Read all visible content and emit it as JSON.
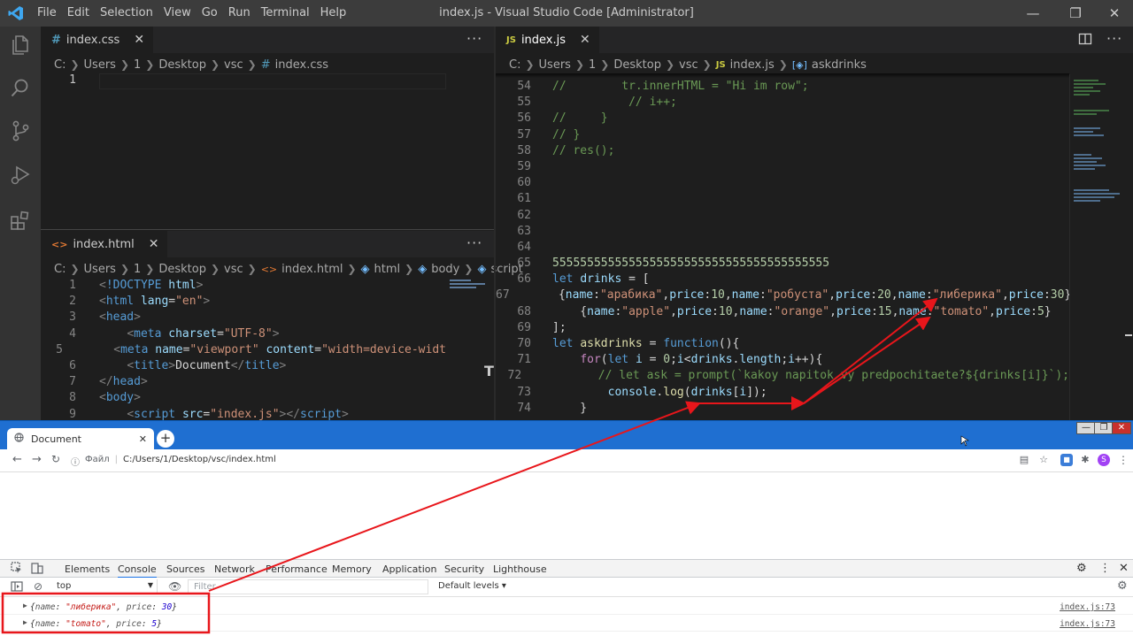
{
  "titlebar": {
    "menu": [
      "File",
      "Edit",
      "Selection",
      "View",
      "Go",
      "Run",
      "Terminal",
      "Help"
    ],
    "title": "index.js - Visual Studio Code [Administrator]"
  },
  "css_editor": {
    "tab_label": "index.css",
    "breadcrumb": [
      "C:",
      "Users",
      "1",
      "Desktop",
      "vsc",
      "index.css"
    ],
    "lines": [
      {
        "n": "1"
      }
    ]
  },
  "html_editor": {
    "tab_label": "index.html",
    "breadcrumb": [
      "C:",
      "Users",
      "1",
      "Desktop",
      "vsc",
      "index.html",
      "html",
      "body",
      "script"
    ],
    "lines": [
      {
        "n": "1",
        "tokens": [
          [
            "c-punc",
            "<"
          ],
          [
            "c-tag",
            "!DOCTYPE "
          ],
          [
            "c-attr",
            "html"
          ],
          [
            "c-punc",
            ">"
          ]
        ]
      },
      {
        "n": "2",
        "tokens": [
          [
            "c-punc",
            "<"
          ],
          [
            "c-tag",
            "html "
          ],
          [
            "c-attr",
            "lang"
          ],
          [
            "c-txt",
            "="
          ],
          [
            "c-str",
            "\"en\""
          ],
          [
            "c-punc",
            ">"
          ]
        ]
      },
      {
        "n": "3",
        "tokens": [
          [
            "c-punc",
            "<"
          ],
          [
            "c-tag",
            "head"
          ],
          [
            "c-punc",
            ">"
          ]
        ]
      },
      {
        "n": "4",
        "tokens": [
          [
            "c-txt",
            "    "
          ],
          [
            "c-punc",
            "<"
          ],
          [
            "c-tag",
            "meta "
          ],
          [
            "c-attr",
            "charset"
          ],
          [
            "c-txt",
            "="
          ],
          [
            "c-str",
            "\"UTF-8\""
          ],
          [
            "c-punc",
            ">"
          ]
        ]
      },
      {
        "n": "5",
        "tokens": [
          [
            "c-txt",
            "    "
          ],
          [
            "c-punc",
            "<"
          ],
          [
            "c-tag",
            "meta "
          ],
          [
            "c-attr",
            "name"
          ],
          [
            "c-txt",
            "="
          ],
          [
            "c-str",
            "\"viewport\" "
          ],
          [
            "c-attr",
            "content"
          ],
          [
            "c-txt",
            "="
          ],
          [
            "c-str",
            "\"width=device-widt"
          ]
        ]
      },
      {
        "n": "6",
        "tokens": [
          [
            "c-txt",
            "    "
          ],
          [
            "c-punc",
            "<"
          ],
          [
            "c-tag",
            "title"
          ],
          [
            "c-punc",
            ">"
          ],
          [
            "c-txt",
            "Document"
          ],
          [
            "c-punc",
            "</"
          ],
          [
            "c-tag",
            "title"
          ],
          [
            "c-punc",
            ">"
          ]
        ]
      },
      {
        "n": "7",
        "tokens": [
          [
            "c-punc",
            "</"
          ],
          [
            "c-tag",
            "head"
          ],
          [
            "c-punc",
            ">"
          ]
        ]
      },
      {
        "n": "8",
        "tokens": [
          [
            "c-punc",
            "<"
          ],
          [
            "c-tag",
            "body"
          ],
          [
            "c-punc",
            ">"
          ]
        ]
      },
      {
        "n": "9",
        "tokens": [
          [
            "c-txt",
            "    "
          ],
          [
            "c-punc",
            "<"
          ],
          [
            "c-tag",
            "script "
          ],
          [
            "c-attr",
            "src"
          ],
          [
            "c-txt",
            "="
          ],
          [
            "c-str",
            "\"index.js\""
          ],
          [
            "c-punc",
            ">"
          ],
          [
            "c-punc",
            "</"
          ],
          [
            "c-tag",
            "script"
          ],
          [
            "c-punc",
            ">"
          ]
        ]
      }
    ]
  },
  "js_editor": {
    "tab_label": "index.js",
    "tab_badge": "JS",
    "breadcrumb": [
      "C:",
      "Users",
      "1",
      "Desktop",
      "vsc",
      "index.js",
      "askdrinks"
    ],
    "lines": [
      {
        "n": "54",
        "tokens": [
          [
            "c-com",
            "//        tr.innerHTML = \"Hi im row\";"
          ]
        ]
      },
      {
        "n": "55",
        "tokens": [
          [
            "c-com",
            "           // i++;"
          ]
        ]
      },
      {
        "n": "56",
        "tokens": [
          [
            "c-com",
            "//     }"
          ]
        ]
      },
      {
        "n": "57",
        "tokens": [
          [
            "c-com",
            "// }"
          ]
        ]
      },
      {
        "n": "58",
        "tokens": [
          [
            "c-com",
            "// res();"
          ]
        ]
      },
      {
        "n": "59",
        "tokens": []
      },
      {
        "n": "60",
        "tokens": []
      },
      {
        "n": "61",
        "tokens": []
      },
      {
        "n": "62",
        "tokens": []
      },
      {
        "n": "63",
        "tokens": []
      },
      {
        "n": "64",
        "tokens": []
      },
      {
        "n": "65",
        "tokens": [
          [
            "c-num",
            "5555555555555555555555555555555555555555"
          ]
        ]
      },
      {
        "n": "66",
        "tokens": [
          [
            "c-kw",
            "let "
          ],
          [
            "c-var",
            "drinks"
          ],
          [
            "c-txt",
            " = ["
          ]
        ]
      },
      {
        "n": "67",
        "tokens": [
          [
            "c-txt",
            "    {"
          ],
          [
            "c-var",
            "name"
          ],
          [
            "c-txt",
            ":"
          ],
          [
            "c-str",
            "\"арабика\""
          ],
          [
            "c-txt",
            ","
          ],
          [
            "c-var",
            "price"
          ],
          [
            "c-txt",
            ":"
          ],
          [
            "c-num",
            "10"
          ],
          [
            "c-txt",
            ","
          ],
          [
            "c-var",
            "name"
          ],
          [
            "c-txt",
            ":"
          ],
          [
            "c-str",
            "\"робуста\""
          ],
          [
            "c-txt",
            ","
          ],
          [
            "c-var",
            "price"
          ],
          [
            "c-txt",
            ":"
          ],
          [
            "c-num",
            "20"
          ],
          [
            "c-txt",
            ","
          ],
          [
            "c-var",
            "name"
          ],
          [
            "c-txt",
            ":"
          ],
          [
            "c-str",
            "\"либерика\""
          ],
          [
            "c-txt",
            ","
          ],
          [
            "c-var",
            "price"
          ],
          [
            "c-txt",
            ":"
          ],
          [
            "c-num",
            "30"
          ],
          [
            "c-txt",
            "},"
          ]
        ]
      },
      {
        "n": "68",
        "tokens": [
          [
            "c-txt",
            "    {"
          ],
          [
            "c-var",
            "name"
          ],
          [
            "c-txt",
            ":"
          ],
          [
            "c-str",
            "\"apple\""
          ],
          [
            "c-txt",
            ","
          ],
          [
            "c-var",
            "price"
          ],
          [
            "c-txt",
            ":"
          ],
          [
            "c-num",
            "10"
          ],
          [
            "c-txt",
            ","
          ],
          [
            "c-var",
            "name"
          ],
          [
            "c-txt",
            ":"
          ],
          [
            "c-str",
            "\"orange\""
          ],
          [
            "c-txt",
            ","
          ],
          [
            "c-var",
            "price"
          ],
          [
            "c-txt",
            ":"
          ],
          [
            "c-num",
            "15"
          ],
          [
            "c-txt",
            ","
          ],
          [
            "c-var",
            "name"
          ],
          [
            "c-txt",
            ":"
          ],
          [
            "c-str",
            "\"tomato\""
          ],
          [
            "c-txt",
            ","
          ],
          [
            "c-var",
            "price"
          ],
          [
            "c-txt",
            ":"
          ],
          [
            "c-num",
            "5"
          ],
          [
            "c-txt",
            "}"
          ]
        ]
      },
      {
        "n": "69",
        "tokens": [
          [
            "c-txt",
            "];"
          ]
        ]
      },
      {
        "n": "70",
        "tokens": [
          [
            "c-kw",
            "let "
          ],
          [
            "c-fn",
            "askdrinks"
          ],
          [
            "c-txt",
            " = "
          ],
          [
            "c-kw",
            "function"
          ],
          [
            "c-txt",
            "(){"
          ]
        ]
      },
      {
        "n": "71",
        "tokens": [
          [
            "c-txt",
            "    "
          ],
          [
            "c-ctrl",
            "for"
          ],
          [
            "c-txt",
            "("
          ],
          [
            "c-kw",
            "let "
          ],
          [
            "c-var",
            "i"
          ],
          [
            "c-txt",
            " = "
          ],
          [
            "c-num",
            "0"
          ],
          [
            "c-txt",
            ";"
          ],
          [
            "c-var",
            "i"
          ],
          [
            "c-txt",
            "<"
          ],
          [
            "c-var",
            "drinks"
          ],
          [
            "c-txt",
            "."
          ],
          [
            "c-var",
            "length"
          ],
          [
            "c-txt",
            ";"
          ],
          [
            "c-var",
            "i"
          ],
          [
            "c-txt",
            "++){"
          ]
        ]
      },
      {
        "n": "72",
        "tokens": [
          [
            "c-txt",
            "        "
          ],
          [
            "c-com",
            "// let ask = prompt(`kakoy napitok vy predpochitaete?${drinks[i]}`);"
          ]
        ]
      },
      {
        "n": "73",
        "tokens": [
          [
            "c-txt",
            "        "
          ],
          [
            "c-var",
            "console"
          ],
          [
            "c-txt",
            "."
          ],
          [
            "c-fn",
            "log"
          ],
          [
            "c-txt",
            "("
          ],
          [
            "c-var",
            "drinks"
          ],
          [
            "c-txt",
            "["
          ],
          [
            "c-var",
            "i"
          ],
          [
            "c-txt",
            "]);"
          ]
        ]
      },
      {
        "n": "74",
        "tokens": [
          [
            "c-txt",
            "    }"
          ]
        ]
      }
    ]
  },
  "browser": {
    "tab_title": "Document",
    "url_prefix": "Файл",
    "url": "C:/Users/1/Desktop/vsc/index.html",
    "profile_initial": "S",
    "devtools_tabs": [
      "Elements",
      "Console",
      "Sources",
      "Network",
      "Performance",
      "Memory",
      "Application",
      "Security",
      "Lighthouse"
    ],
    "active_devtools_tab": "Console",
    "console_context": "top",
    "filter_placeholder": "Filter",
    "levels": "Default levels ▾",
    "messages": [
      {
        "name_key": "name",
        "name_value": "\"либерика\"",
        "price_key": "price",
        "price_value": "30",
        "source": "index.js:73"
      },
      {
        "name_key": "name",
        "name_value": "\"tomato\"",
        "price_key": "price",
        "price_value": "5",
        "source": "index.js:73"
      }
    ]
  },
  "colors": {
    "annotation": "#e8161b",
    "chrome_blue": "#1f6fd1"
  }
}
